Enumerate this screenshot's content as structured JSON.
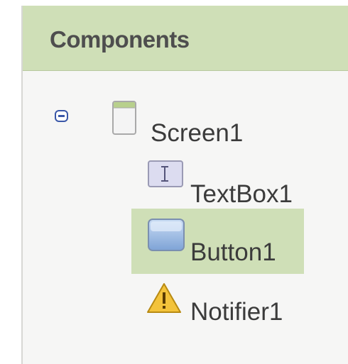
{
  "panel": {
    "title": "Components"
  },
  "tree": {
    "root": {
      "label": "Screen1",
      "icon": "screen-icon",
      "expanded": true
    },
    "children": [
      {
        "label": "TextBox1",
        "icon": "textbox-icon",
        "selected": false
      },
      {
        "label": "Button1",
        "icon": "button-icon",
        "selected": true
      },
      {
        "label": "Notifier1",
        "icon": "notifier-icon",
        "selected": false
      }
    ]
  },
  "colors": {
    "header_bg": "#cfdfb7",
    "selection_bg": "#cfdfb7",
    "panel_bg": "#f6f6f5",
    "toggle_blue": "#3a57a8"
  }
}
